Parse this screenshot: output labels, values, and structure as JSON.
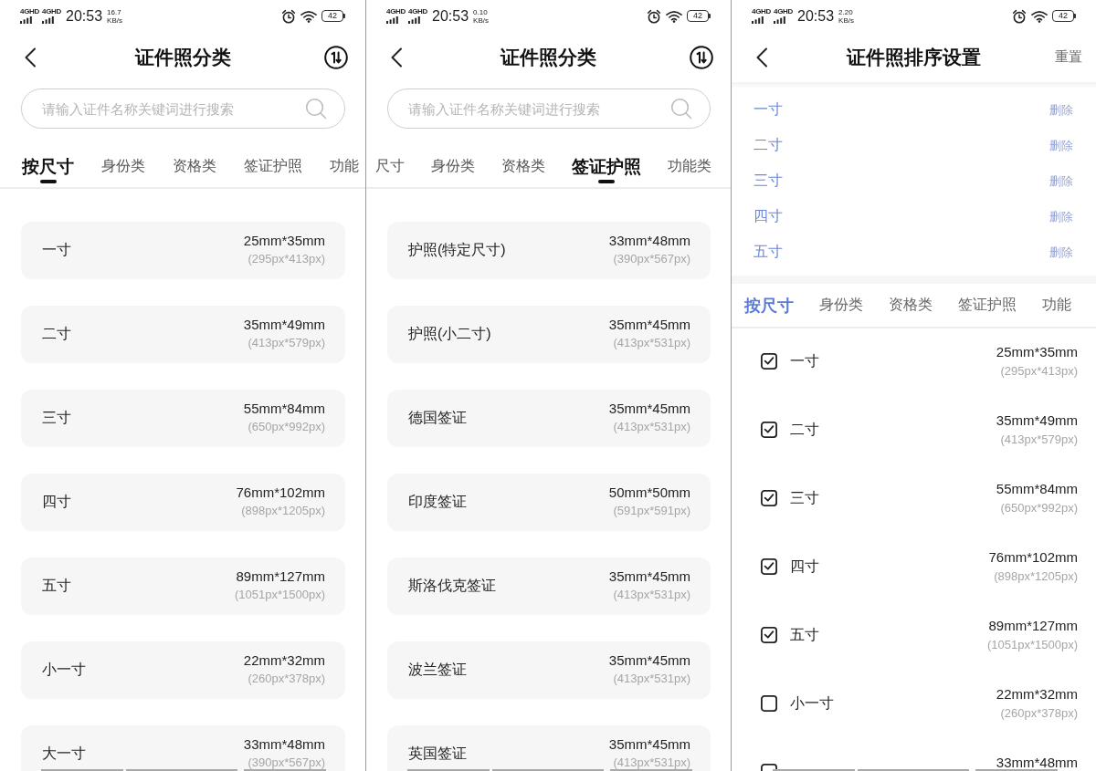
{
  "screens": [
    {
      "kind": "category",
      "status_bar": {
        "networks": [
          "4GHD",
          "4GHD"
        ],
        "time": "20:53",
        "speed": "16.7",
        "speed_unit": "KB/s",
        "battery": "42"
      },
      "header": {
        "title": "证件照分类"
      },
      "search": {
        "placeholder": "请输入证件名称关键词进行搜索"
      },
      "tabs": [
        {
          "label": "按尺寸",
          "selected": true
        },
        {
          "label": "身份类",
          "selected": false
        },
        {
          "label": "资格类",
          "selected": false
        },
        {
          "label": "签证护照",
          "selected": false
        },
        {
          "label": "功能",
          "selected": false
        }
      ],
      "items": [
        {
          "name": "一寸",
          "size": "25mm*35mm",
          "pixels": "(295px*413px)"
        },
        {
          "name": "二寸",
          "size": "35mm*49mm",
          "pixels": "(413px*579px)"
        },
        {
          "name": "三寸",
          "size": "55mm*84mm",
          "pixels": "(650px*992px)"
        },
        {
          "name": "四寸",
          "size": "76mm*102mm",
          "pixels": "(898px*1205px)"
        },
        {
          "name": "五寸",
          "size": "89mm*127mm",
          "pixels": "(1051px*1500px)"
        },
        {
          "name": "小一寸",
          "size": "22mm*32mm",
          "pixels": "(260px*378px)"
        },
        {
          "name": "大一寸",
          "size": "33mm*48mm",
          "pixels": "(390px*567px)"
        }
      ]
    },
    {
      "kind": "category",
      "status_bar": {
        "networks": [
          "4GHD",
          "4GHD"
        ],
        "time": "20:53",
        "speed": "0.10",
        "speed_unit": "KB/s",
        "battery": "42"
      },
      "header": {
        "title": "证件照分类"
      },
      "search": {
        "placeholder": "请输入证件名称关键词进行搜索"
      },
      "tabs": [
        {
          "label": "尺寸",
          "selected": false
        },
        {
          "label": "身份类",
          "selected": false
        },
        {
          "label": "资格类",
          "selected": false
        },
        {
          "label": "签证护照",
          "selected": true
        },
        {
          "label": "功能类",
          "selected": false
        }
      ],
      "items": [
        {
          "name": "护照(特定尺寸)",
          "size": "33mm*48mm",
          "pixels": "(390px*567px)"
        },
        {
          "name": "护照(小二寸)",
          "size": "35mm*45mm",
          "pixels": "(413px*531px)"
        },
        {
          "name": "德国签证",
          "size": "35mm*45mm",
          "pixels": "(413px*531px)"
        },
        {
          "name": "印度签证",
          "size": "50mm*50mm",
          "pixels": "(591px*591px)"
        },
        {
          "name": "斯洛伐克签证",
          "size": "35mm*45mm",
          "pixels": "(413px*531px)"
        },
        {
          "name": "波兰签证",
          "size": "35mm*45mm",
          "pixels": "(413px*531px)"
        },
        {
          "name": "英国签证",
          "size": "35mm*45mm",
          "pixels": "(413px*531px)"
        }
      ]
    },
    {
      "kind": "sort_settings",
      "status_bar": {
        "networks": [
          "4GHD",
          "4GHD"
        ],
        "time": "20:53",
        "speed": "2.20",
        "speed_unit": "KB/s",
        "battery": "42"
      },
      "header": {
        "title": "证件照排序设置",
        "action": "重置"
      },
      "sorted_items": [
        {
          "name": "一寸",
          "action": "删除"
        },
        {
          "name": "二寸",
          "action": "删除"
        },
        {
          "name": "三寸",
          "action": "删除"
        },
        {
          "name": "四寸",
          "action": "删除"
        },
        {
          "name": "五寸",
          "action": "删除"
        }
      ],
      "tabs": [
        {
          "label": "按尺寸",
          "selected": true
        },
        {
          "label": "身份类",
          "selected": false
        },
        {
          "label": "资格类",
          "selected": false
        },
        {
          "label": "签证护照",
          "selected": false
        },
        {
          "label": "功能",
          "selected": false
        }
      ],
      "items": [
        {
          "name": "一寸",
          "size": "25mm*35mm",
          "pixels": "(295px*413px)",
          "checked": true
        },
        {
          "name": "二寸",
          "size": "35mm*49mm",
          "pixels": "(413px*579px)",
          "checked": true
        },
        {
          "name": "三寸",
          "size": "55mm*84mm",
          "pixels": "(650px*992px)",
          "checked": true
        },
        {
          "name": "四寸",
          "size": "76mm*102mm",
          "pixels": "(898px*1205px)",
          "checked": true
        },
        {
          "name": "五寸",
          "size": "89mm*127mm",
          "pixels": "(1051px*1500px)",
          "checked": true
        },
        {
          "name": "小一寸",
          "size": "22mm*32mm",
          "pixels": "(260px*378px)",
          "checked": false
        },
        {
          "size": "33mm*48mm",
          "checked": false
        }
      ]
    }
  ]
}
